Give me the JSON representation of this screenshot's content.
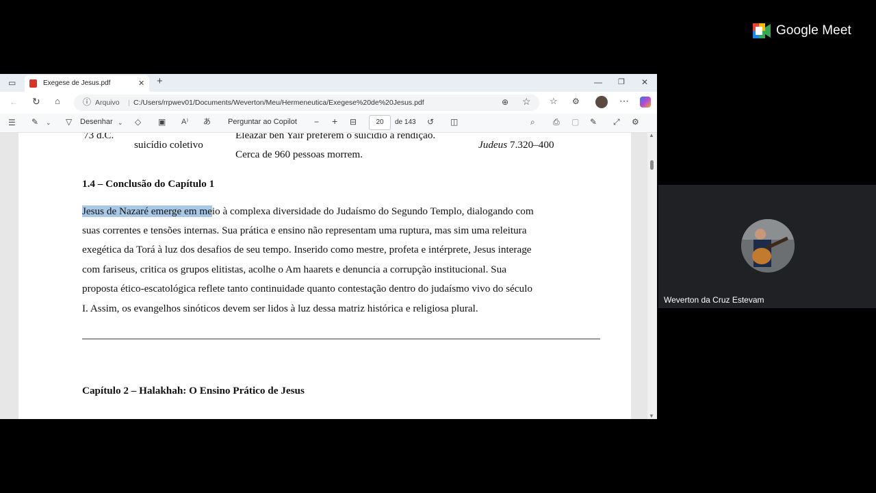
{
  "meet": {
    "brand": "Google Meet",
    "participant_name": "Weverton da Cruz Estevam"
  },
  "browser": {
    "tab_title": "Exegese de Jesus.pdf",
    "url_label": "Arquivo",
    "url": "C:/Users/rrpwev01/Documents/Weverton/Meu/Hermeneutica/Exegese%20de%20Jesus.pdf"
  },
  "pdf_toolbar": {
    "draw_label": "Desenhar",
    "ask_copilot": "Perguntar ao Copilot",
    "page_number": "20",
    "page_count": "de 143"
  },
  "document": {
    "table_row": {
      "date": "73 d.C.",
      "event": "suicídio coletivo",
      "desc_line1": "Eleazar ben Yair preferem o suicídio à rendição.",
      "desc_line2": "Cerca de 960 pessoas morrem.",
      "source_italic": "Judeus",
      "source_ref": " 7.320–400"
    },
    "section_heading": "1.4 – Conclusão do Capítulo 1",
    "paragraph": {
      "highlighted": "Jesus de Nazaré emerge em me",
      "line1_rest": "io à complexa diversidade do Judaísmo do Segundo Templo, dialogando com",
      "lines": [
        "suas correntes e tensões internas. Sua prática e ensino não representam uma ruptura, mas sim uma releitura",
        "exegética da Torá à luz dos desafios de seu tempo. Inserido como mestre, profeta e intérprete, Jesus interage",
        "com fariseus, critica os grupos elitistas, acolhe o Am haarets e denuncia a corrupção institucional. Sua",
        "proposta ético-escatológica reflete tanto continuidade quanto contestação dentro do judaísmo vivo do século",
        "I. Assim, os evangelhos sinóticos devem ser lidos à luz dessa matriz histórica e religiosa plural."
      ]
    },
    "chapter_heading": "Capítulo 2 – Halakhah: O Ensino Prático de Jesus"
  }
}
